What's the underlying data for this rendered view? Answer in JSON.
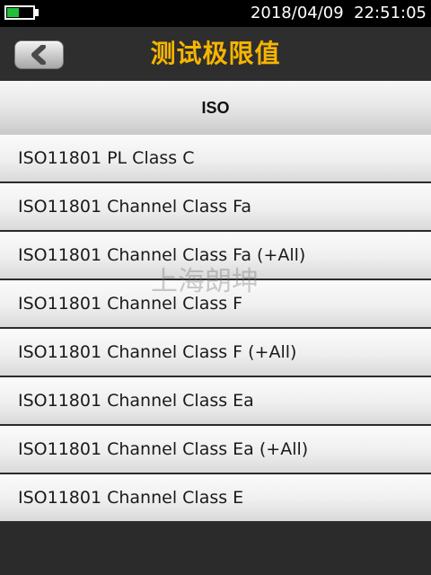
{
  "status_bar": {
    "battery_level": 0.45,
    "battery_color": "#1fbf3a",
    "date": "2018/04/09",
    "time": "22:51:05"
  },
  "header": {
    "back_icon": "chevron-left-icon",
    "title": "测试极限值",
    "title_color": "#f7b500"
  },
  "category": {
    "label": "ISO"
  },
  "list": {
    "items": [
      {
        "label": "ISO11801 PL Class C"
      },
      {
        "label": "ISO11801 Channel Class Fa"
      },
      {
        "label": "ISO11801 Channel Class Fa (+All)"
      },
      {
        "label": "ISO11801 Channel Class F"
      },
      {
        "label": "ISO11801 Channel Class F (+All)"
      },
      {
        "label": "ISO11801 Channel Class Ea"
      },
      {
        "label": "ISO11801 Channel Class Ea (+All)"
      },
      {
        "label": "ISO11801 Channel Class E"
      }
    ]
  },
  "watermark": {
    "text": "上海朗坤"
  }
}
